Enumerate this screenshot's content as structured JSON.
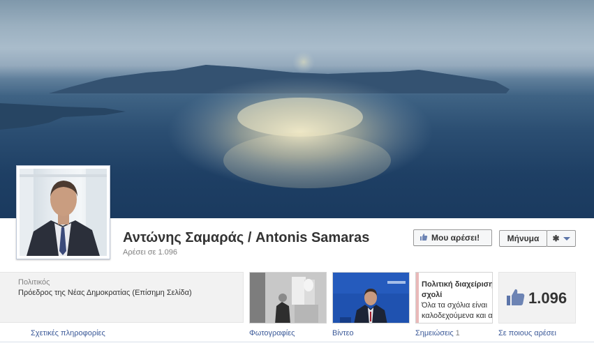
{
  "page": {
    "name": "Αντώνης Σαμαράς / Antonis Samaras",
    "likes_text": "Αρέσει σε 1.096"
  },
  "actions": {
    "like_label": "Μου αρέσει!",
    "message_label": "Μήνυμα"
  },
  "info": {
    "category": "Πολιτικός",
    "description": "Πρόεδρος της Νέας Δημοκρατίας (Επίσημη Σελίδα)"
  },
  "notes_tile": {
    "title": "Πολιτική διαχείριση σχολί",
    "body_line1": "Όλα τα σχόλια είναι",
    "body_line2": "καλοδεχούμενα και α"
  },
  "likes_tile": {
    "count": "1.096"
  },
  "tabs": {
    "about": "Σχετικές πληροφορίες",
    "photos": "Φωτογραφίες",
    "video": "Βίντεο",
    "notes": "Σημειώσεις",
    "notes_count": "1",
    "likes": "Σε ποιους αρέσει"
  },
  "colors": {
    "link": "#3b5998",
    "video_bg": "#1f52b0",
    "sea": "#2b4e72"
  },
  "icons": {
    "like_button": "thumbs-up-icon",
    "gear": "gear-icon",
    "likes_tile": "thumbs-up-icon"
  }
}
